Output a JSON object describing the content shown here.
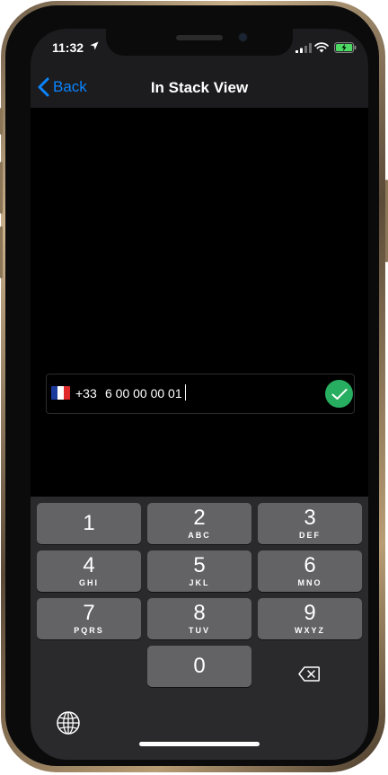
{
  "status_bar": {
    "time": "11:32"
  },
  "nav": {
    "back_label": "Back",
    "title": "In Stack View"
  },
  "phone_input": {
    "country_flag": "France",
    "flag_colors": [
      "#1a3a9c",
      "#ffffff",
      "#e02a2a"
    ],
    "dial_code": "+33",
    "number": "6 00 00 00 01"
  },
  "keypad": {
    "keys": [
      {
        "digit": "1",
        "letters": ""
      },
      {
        "digit": "2",
        "letters": "ABC"
      },
      {
        "digit": "3",
        "letters": "DEF"
      },
      {
        "digit": "4",
        "letters": "GHI"
      },
      {
        "digit": "5",
        "letters": "JKL"
      },
      {
        "digit": "6",
        "letters": "MNO"
      },
      {
        "digit": "7",
        "letters": "PQRS"
      },
      {
        "digit": "8",
        "letters": "TUV"
      },
      {
        "digit": "9",
        "letters": "WXYZ"
      },
      {
        "digit": "0",
        "letters": ""
      }
    ],
    "delete_icon": "delete-backspace-icon",
    "globe_icon": "globe-icon"
  },
  "colors": {
    "accent": "#0a84ff",
    "valid": "#27ae60",
    "key": "#636366",
    "keypad_bg": "#2a2a2c"
  }
}
